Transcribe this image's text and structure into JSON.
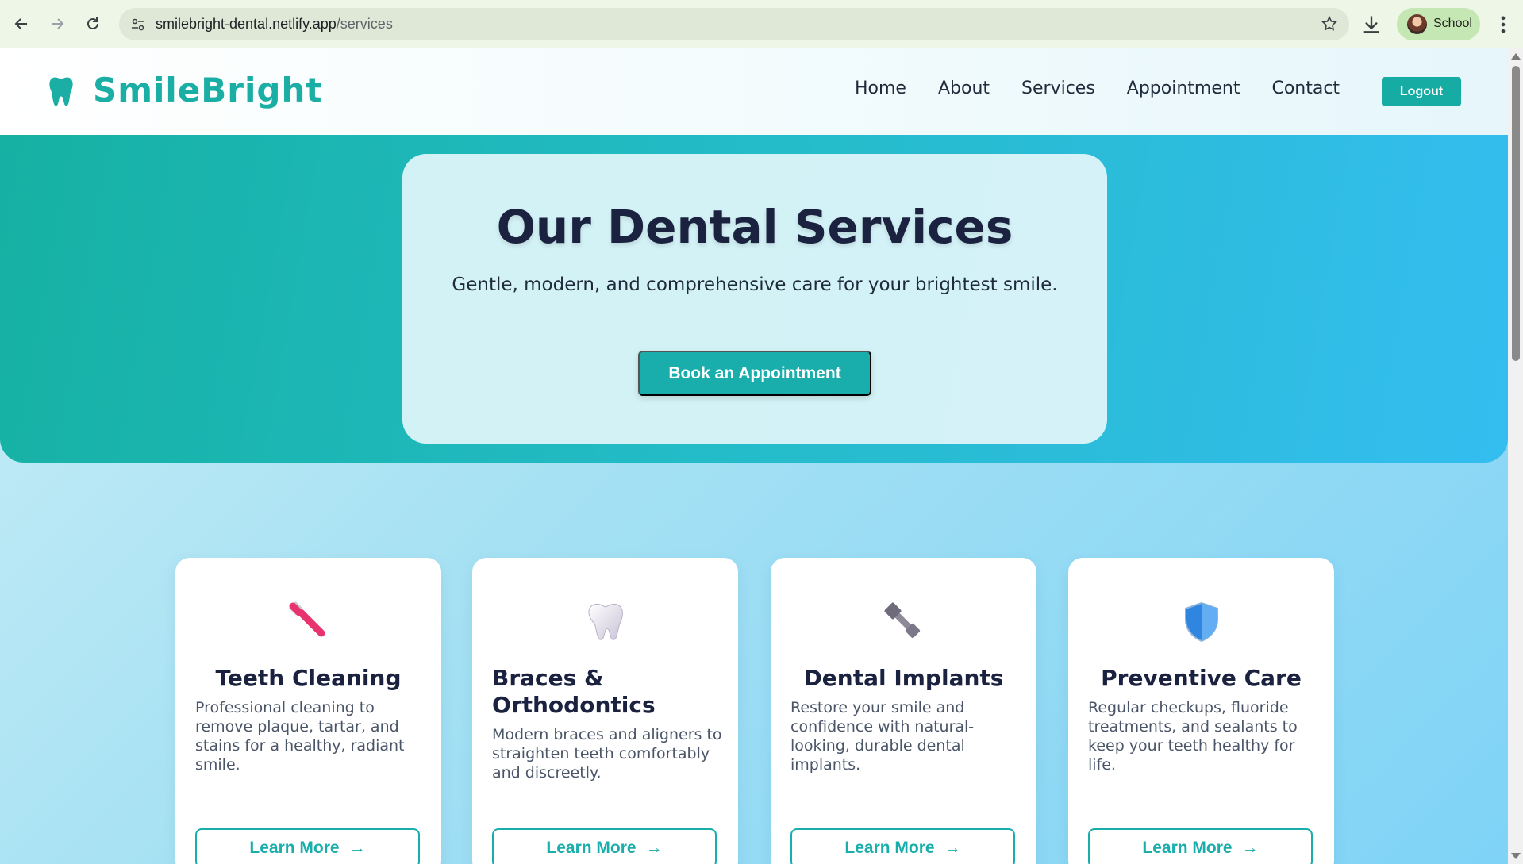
{
  "browser": {
    "url_domain": "smilebright-dental.netlify.app",
    "url_path": "/services",
    "profile_name": "School",
    "icons": [
      "back-arrow-icon",
      "forward-arrow-icon",
      "reload-icon",
      "site-settings-icon",
      "bookmark-star-icon",
      "download-icon",
      "kebab-menu-icon"
    ]
  },
  "header": {
    "logo_text": "SmileBright",
    "logo_icon": "tooth-icon",
    "nav": [
      "Home",
      "About",
      "Services",
      "Appointment",
      "Contact"
    ],
    "logout_label": "Logout"
  },
  "hero": {
    "title": "Our Dental Services",
    "subtitle": "Gentle, modern, and comprehensive care for your brightest smile.",
    "cta_label": "Book an Appointment"
  },
  "services": [
    {
      "icon": "toothbrush-icon",
      "title": "Teeth Cleaning",
      "description": "Professional cleaning to remove plaque, tartar, and stains for a healthy, radiant smile.",
      "button": "Learn More",
      "arrow": "→"
    },
    {
      "icon": "tooth-icon",
      "title": "Braces & Orthodontics",
      "description": "Modern braces and aligners to straighten teeth comfortably and discreetly.",
      "button": "Learn More",
      "arrow": "→"
    },
    {
      "icon": "bolt-nut-icon",
      "title": "Dental Implants",
      "description": "Restore your smile and confidence with natural-looking, durable dental implants.",
      "button": "Learn More",
      "arrow": "→"
    },
    {
      "icon": "shield-icon",
      "title": "Preventive Care",
      "description": "Regular checkups, fluoride treatments, and sealants to keep your teeth healthy for life.",
      "button": "Learn More",
      "arrow": "→"
    }
  ],
  "colors": {
    "brand": "#1aaea4",
    "primary_button": "#19aeac",
    "heading": "#1b2240",
    "chrome_bg": "#eef6e7"
  }
}
